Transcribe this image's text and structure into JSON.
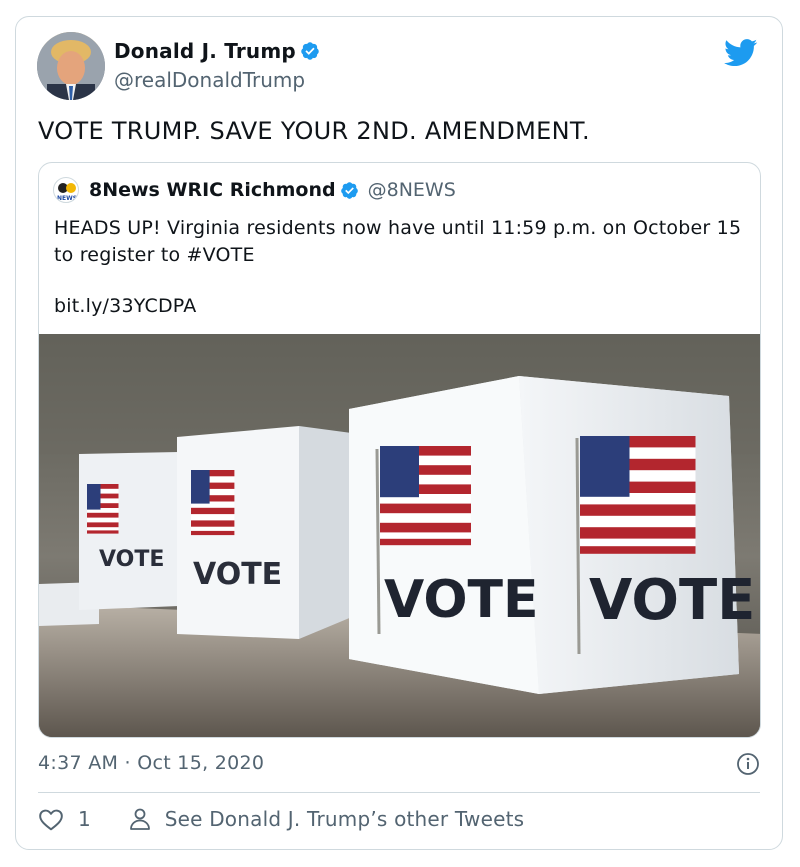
{
  "tweet": {
    "author_name": "Donald J. Trump",
    "author_handle": "@realDonaldTrump",
    "text": "VOTE TRUMP. SAVE YOUR 2ND. AMENDMENT.",
    "timestamp": "4:37 AM · Oct 15, 2020",
    "like_count": "1",
    "see_other_tweets": "See Donald J. Trump’s other Tweets"
  },
  "quoted": {
    "author_name": "8News WRIC Richmond",
    "author_handle": "@8NEWS",
    "logo_text": "NEWS",
    "text": "HEADS UP! Virginia residents now have until 11:59 p.m. on October 15 to register to #VOTE",
    "link": "bit.ly/33YCDPA",
    "image_box_label": "VOTE"
  },
  "icons": {
    "brand": "twitter-bird-icon",
    "verified": "verified-badge-icon",
    "info": "info-icon",
    "like": "heart-icon",
    "profile": "person-icon"
  },
  "colors": {
    "twitter_blue": "#1d9bf0",
    "text": "#0f1419",
    "secondary": "#536471",
    "border": "#cfd9de"
  }
}
